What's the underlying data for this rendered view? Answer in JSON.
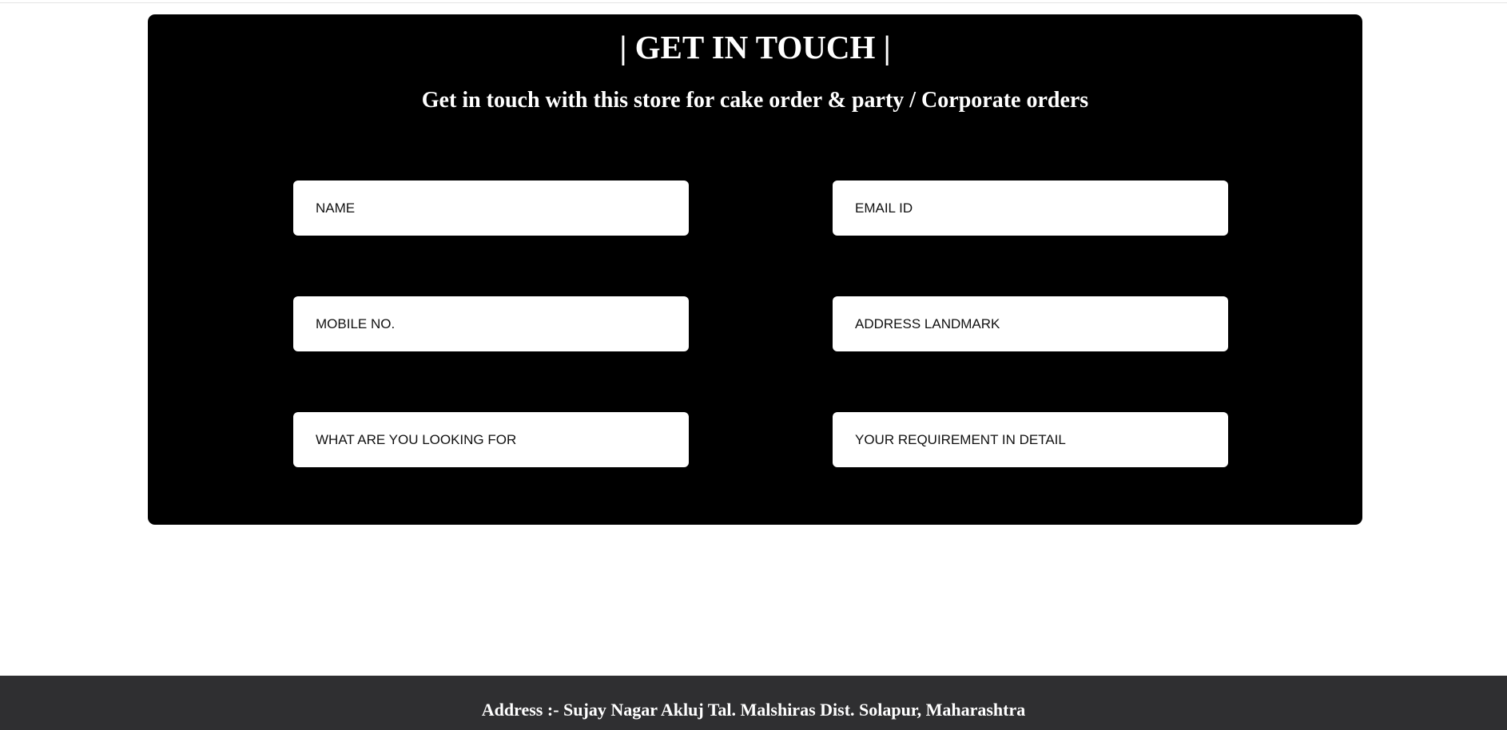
{
  "contact": {
    "title": "| GET IN TOUCH |",
    "subtitle": "Get in touch with this store for cake order & party / Corporate orders",
    "fields": {
      "name": {
        "placeholder": "NAME",
        "value": ""
      },
      "email": {
        "placeholder": "EMAIL ID",
        "value": ""
      },
      "mobile": {
        "placeholder": "MOBILE NO.",
        "value": ""
      },
      "address": {
        "placeholder": "ADDRESS LANDMARK",
        "value": ""
      },
      "looking_for": {
        "placeholder": "WHAT ARE YOU LOOKING FOR",
        "value": ""
      },
      "requirement": {
        "placeholder": "YOUR REQUIREMENT IN DETAIL",
        "value": ""
      }
    }
  },
  "footer": {
    "address": "Address :- Sujay Nagar Akluj Tal. Malshiras Dist. Solapur, Maharashtra"
  },
  "colors": {
    "panel_background": "#000000",
    "footer_background": "#2f2f31",
    "field_background": "#ffffff",
    "text_light": "#ffffff"
  }
}
